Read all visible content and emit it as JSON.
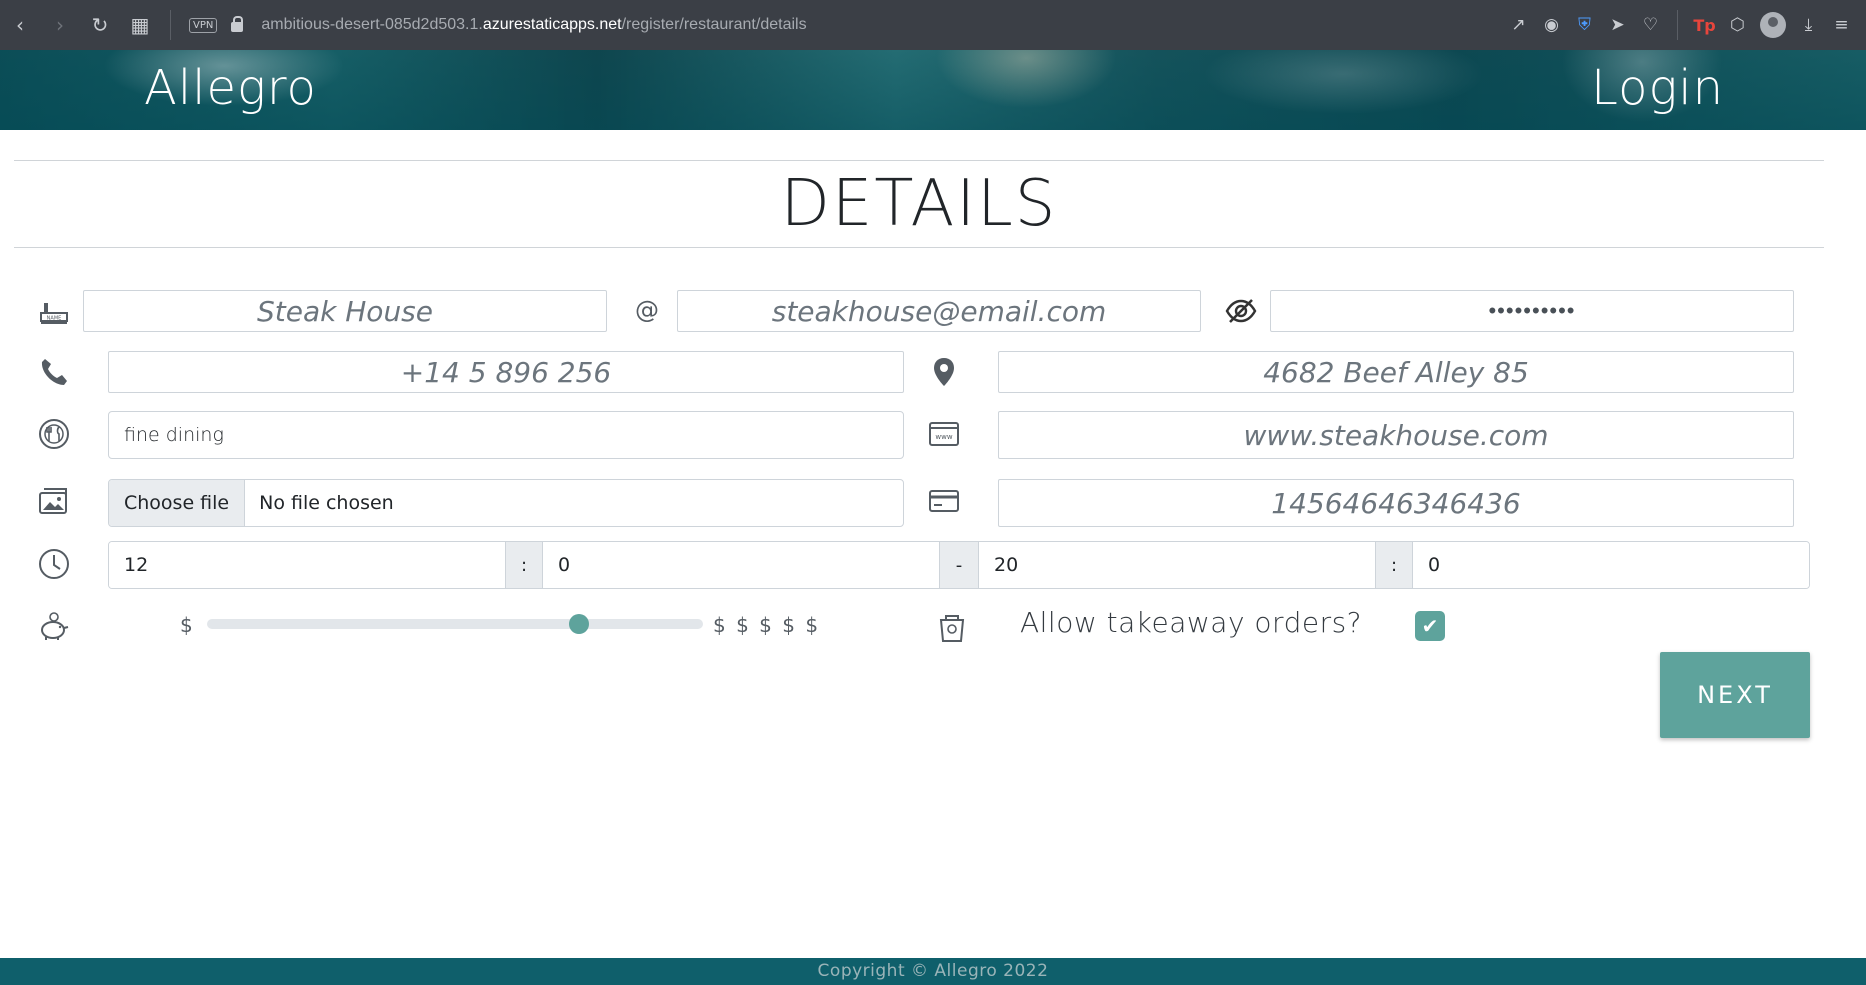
{
  "browser": {
    "url_prefix": "ambitious-desert-085d2d503.1.",
    "url_domain": "azurestaticapps.net",
    "url_path": "/register/restaurant/details",
    "vpn_label": "VPN"
  },
  "header": {
    "brand": "Allegro",
    "login": "Login"
  },
  "page": {
    "title": "DETAILS"
  },
  "form": {
    "name_placeholder": "Steak House",
    "at_symbol": "@",
    "email_placeholder": "steakhouse@email.com",
    "password_value": "••••••••••",
    "phone_placeholder": "+14 5 896 256",
    "address_placeholder": "4682 Beef Alley 85",
    "category_value": "fine dining",
    "website_placeholder": "www.steakhouse.com",
    "file_button": "Choose file",
    "file_text": "No file chosen",
    "card_placeholder": "14564646346436",
    "open_hour": "12",
    "open_minute": "0",
    "close_hour": "20",
    "close_minute": "0",
    "time_colon": ":",
    "time_dash": "-",
    "price_min_label": "$",
    "price_max_label": "$ $ $ $ $",
    "price_level": 0.75,
    "takeaway_label": "Allow takeaway orders?",
    "takeaway_checked": true,
    "next_button": "NEXT"
  },
  "footer": {
    "copyright": "Copyright © Allegro 2022"
  },
  "colors": {
    "accent": "#5ea39c",
    "footer_bg": "#0f5f6b"
  }
}
